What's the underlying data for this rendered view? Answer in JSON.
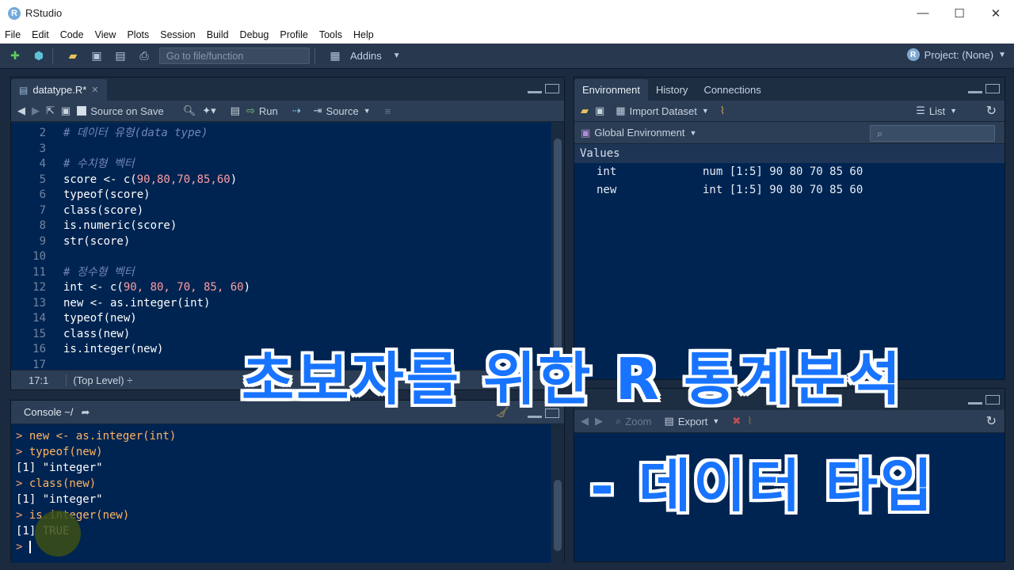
{
  "window": {
    "title": "RStudio",
    "controls": [
      "—",
      "☐",
      "✕"
    ]
  },
  "menu": [
    "File",
    "Edit",
    "Code",
    "View",
    "Plots",
    "Session",
    "Build",
    "Debug",
    "Profile",
    "Tools",
    "Help"
  ],
  "toolbar": {
    "goto_placeholder": "Go to file/function",
    "addins": "Addins",
    "project": "Project: (None)"
  },
  "editor": {
    "tab": "datatype.R*",
    "tools": {
      "source_on_save": "Source on Save",
      "run": "Run",
      "source": "Source"
    },
    "lines": [
      {
        "n": "2",
        "text": "# 데이터 유형(data type)",
        "kind": "comment"
      },
      {
        "n": "3",
        "text": "",
        "kind": "code"
      },
      {
        "n": "4",
        "text": "# 수치형 벡터",
        "kind": "comment"
      },
      {
        "n": "5",
        "text": "score <- c(",
        "nums": "90,80,70,85,60",
        "tail": ")",
        "kind": "numcall"
      },
      {
        "n": "6",
        "text": "typeof(score)",
        "kind": "code"
      },
      {
        "n": "7",
        "text": "class(score)",
        "kind": "code"
      },
      {
        "n": "8",
        "text": "is.numeric(score)",
        "kind": "code"
      },
      {
        "n": "9",
        "text": "str(score)",
        "kind": "code"
      },
      {
        "n": "10",
        "text": "",
        "kind": "code"
      },
      {
        "n": "11",
        "text": "# 정수형 벡터",
        "kind": "comment"
      },
      {
        "n": "12",
        "text": "int <- c(",
        "nums": "90, 80, 70, 85, 60",
        "tail": ")",
        "kind": "numcall"
      },
      {
        "n": "13",
        "text": "new <- as.integer(int)",
        "kind": "code"
      },
      {
        "n": "14",
        "text": "typeof(new)",
        "kind": "code"
      },
      {
        "n": "15",
        "text": "class(new)",
        "kind": "code"
      },
      {
        "n": "16",
        "text": "is.integer(new)",
        "kind": "code"
      },
      {
        "n": "17",
        "text": "",
        "kind": "code"
      }
    ],
    "status": {
      "position": "17:1",
      "level": "(Top Level) ÷"
    }
  },
  "console": {
    "title": "Console ~/",
    "lines": [
      {
        "p": "> ",
        "text": "new <- as.integer(int)",
        "kind": "cmd"
      },
      {
        "p": "> ",
        "text": "typeof(new)",
        "kind": "cmd"
      },
      {
        "p": "",
        "text": "[1] \"integer\"",
        "kind": "out"
      },
      {
        "p": "> ",
        "text": "class(new)",
        "kind": "cmd"
      },
      {
        "p": "",
        "text": "[1] \"integer\"",
        "kind": "out"
      },
      {
        "p": "> ",
        "text": "is.integer(new)",
        "kind": "cmd"
      },
      {
        "p": "",
        "text": "[1] TRUE",
        "kind": "out"
      }
    ],
    "prompt": "> "
  },
  "env": {
    "tabs": [
      "Environment",
      "History",
      "Connections"
    ],
    "import": "Import Dataset",
    "list": "List",
    "global": "Global Environment",
    "values_header": "Values",
    "rows": [
      {
        "name": "int",
        "value": "num [1:5] 90 80 70 85 60"
      },
      {
        "name": "new",
        "value": " int [1:5] 90 80 70 85 60"
      }
    ]
  },
  "files": {
    "zoom": "Zoom",
    "export": "Export"
  },
  "overlay": {
    "title": "초보자를 위한 R 통계분석",
    "subtitle": "- 데이터 타입"
  }
}
